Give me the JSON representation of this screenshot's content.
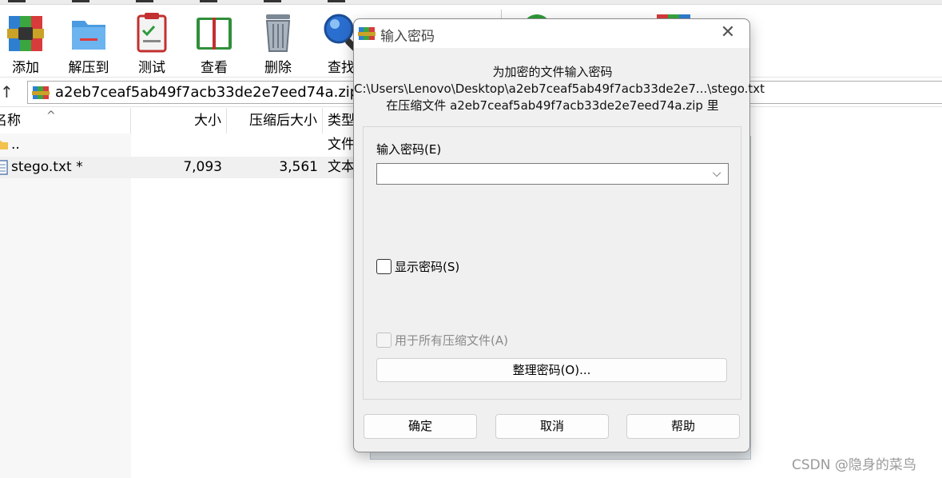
{
  "toolbar": {
    "buttons": [
      {
        "label": "添加",
        "icon": "add-archive-icon"
      },
      {
        "label": "解压到",
        "icon": "extract-to-icon"
      },
      {
        "label": "测试",
        "icon": "test-icon"
      },
      {
        "label": "查看",
        "icon": "view-icon"
      },
      {
        "label": "删除",
        "icon": "delete-icon"
      },
      {
        "label": "查找",
        "icon": "find-icon"
      }
    ]
  },
  "address_bar": {
    "path": "a2eb7ceaf5ab49f7acb33de2e7eed74a.zip - "
  },
  "file_list": {
    "headers": {
      "name": "名称",
      "size": "大小",
      "packed": "压缩后大小",
      "type": "类型"
    },
    "rows": [
      {
        "name": "..",
        "size": "",
        "packed": "",
        "type": "文件"
      },
      {
        "name": "stego.txt *",
        "size": "7,093",
        "packed": "3,561",
        "type": "文本"
      }
    ]
  },
  "dialog": {
    "title": "输入密码",
    "info_line1": "为加密的文件输入密码",
    "info_line2": "C:\\Users\\Lenovo\\Desktop\\a2eb7ceaf5ab49f7acb33de2e7...\\stego.txt",
    "info_line3": "在压缩文件 a2eb7ceaf5ab49f7acb33de2e7eed74a.zip 里",
    "password_label": "输入密码(E)",
    "password_value": "",
    "show_password_label": "显示密码(S)",
    "use_for_all_label": "用于所有压缩文件(A)",
    "organize_button": "整理密码(O)...",
    "ok_button": "确定",
    "cancel_button": "取消",
    "help_button": "帮助",
    "close_glyph": "✕",
    "dropdown_glyph": "⌵"
  },
  "watermark": "CSDN @隐身的菜鸟"
}
